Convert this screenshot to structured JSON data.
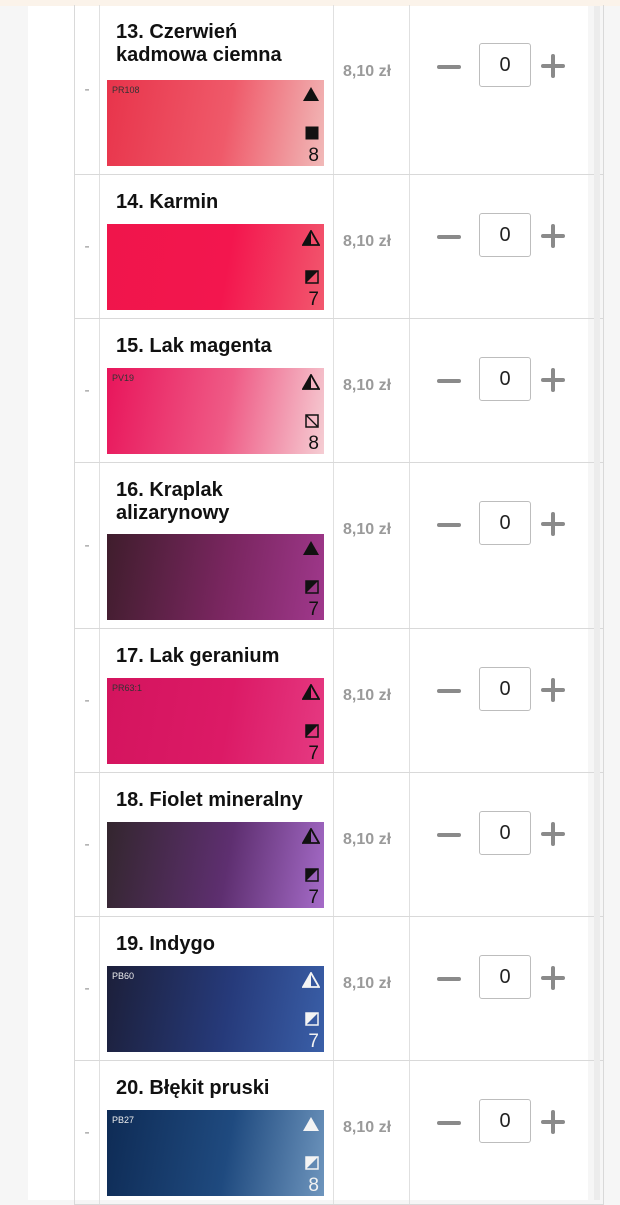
{
  "products": [
    {
      "name": "13. Czerwień kadmowa ciemna",
      "pigment": "PR108",
      "number": "8",
      "price": "8,10 zł",
      "qty": "0",
      "gradient": [
        "#e8344b",
        "#ef5a6a",
        "#f1b9b8"
      ],
      "tri": "filled",
      "square": "filled",
      "light": false
    },
    {
      "name": "14. Karmin",
      "pigment": "",
      "number": "7",
      "price": "8,10 zł",
      "qty": "0",
      "gradient": [
        "#f0154b",
        "#f3164e",
        "#f2586e"
      ],
      "tri": "half",
      "square": "half",
      "light": false
    },
    {
      "name": "15. Lak magenta",
      "pigment": "PV19",
      "number": "8",
      "price": "8,10 zł",
      "qty": "0",
      "gradient": [
        "#e8155b",
        "#ef5b86",
        "#f5cdd3"
      ],
      "tri": "half",
      "square": "empty",
      "light": false
    },
    {
      "name": "16. Kraplak alizarynowy",
      "pigment": "",
      "number": "7",
      "price": "8,10 zł",
      "qty": "0",
      "gradient": [
        "#3f1d2c",
        "#7a2660",
        "#a0388c"
      ],
      "tri": "filled",
      "square": "half",
      "light": false
    },
    {
      "name": "17. Lak geranium",
      "pigment": "PR63:1",
      "number": "7",
      "price": "8,10 zł",
      "qty": "0",
      "gradient": [
        "#d4145e",
        "#dc1a66",
        "#e53a82"
      ],
      "tri": "half",
      "square": "half",
      "light": false
    },
    {
      "name": "18. Fiolet mineralny",
      "pigment": "",
      "number": "7",
      "price": "8,10 zł",
      "qty": "0",
      "gradient": [
        "#33262e",
        "#5e2f70",
        "#a56bc8"
      ],
      "tri": "half",
      "square": "half",
      "light": false
    },
    {
      "name": "19. Indygo",
      "pigment": "PB60",
      "number": "7",
      "price": "8,10 zł",
      "qty": "0",
      "gradient": [
        "#1c1f3a",
        "#263a7a",
        "#3a5fa8"
      ],
      "tri": "half",
      "square": "half",
      "light": true
    },
    {
      "name": "20. Błękit pruski",
      "pigment": "PB27",
      "number": "8",
      "price": "8,10 zł",
      "qty": "0",
      "gradient": [
        "#0e2b55",
        "#1f4a7f",
        "#6e95bd"
      ],
      "tri": "filled",
      "square": "half",
      "light": true
    }
  ],
  "dash": "-",
  "colors": {
    "price": "#9a9a9a",
    "control": "#8a8a8a",
    "border": "#d9d9d9"
  }
}
